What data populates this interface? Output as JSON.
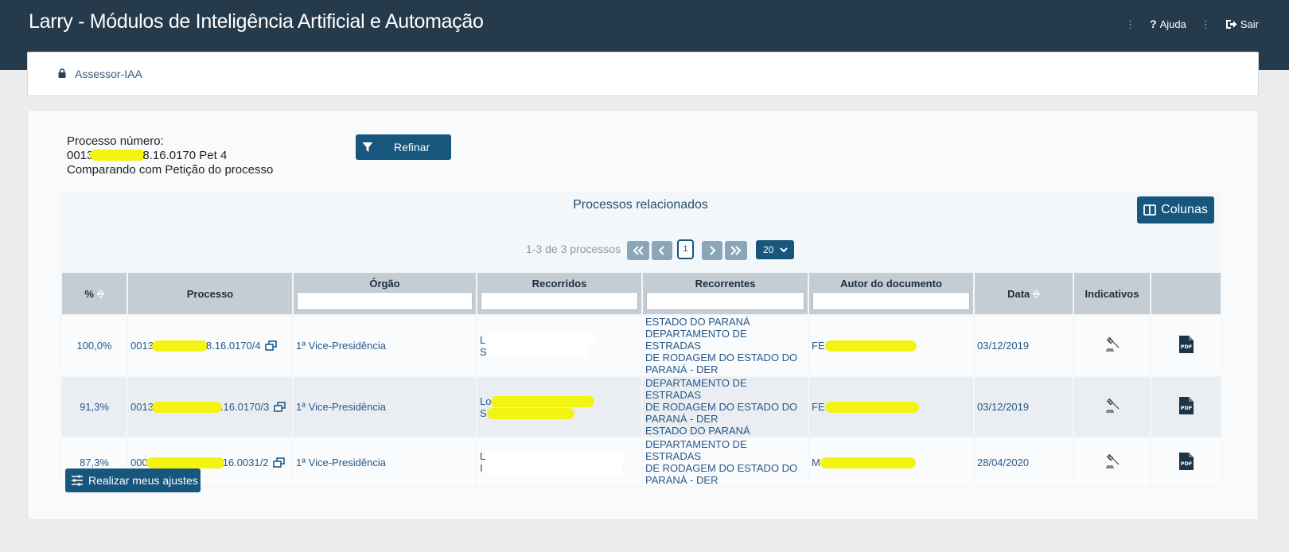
{
  "header": {
    "title": "Larry - Módulos de Inteligência Artificial e Automação",
    "help_label": "Ajuda",
    "exit_label": "Sair"
  },
  "breadcrumb": {
    "label": "Assessor-IAA"
  },
  "process": {
    "label": "Processo número:",
    "number_prefix": "0013",
    "number_suffix": "8.16.0170 Pet 4",
    "comparing": "Comparando com Petição do processo"
  },
  "toolbar": {
    "refine_label": "Refinar",
    "columns_label": "Colunas",
    "adjust_label": "Realizar meus ajustes"
  },
  "panel": {
    "title": "Processos relacionados"
  },
  "pagination": {
    "info": "1-3 de 3 processos",
    "current_page": "1",
    "page_size": "20"
  },
  "table": {
    "columns": {
      "pct": "%",
      "processo": "Processo",
      "orgao": "Órgão",
      "recorridos": "Recorridos",
      "recorrentes": "Recorrentes",
      "autor": "Autor do documento",
      "data": "Data",
      "indicativos": "Indicativos"
    },
    "rows": [
      {
        "pct": "100,0%",
        "proc_prefix": "0013",
        "proc_suffix": "8.16.0170/4",
        "orgao": "1ª Vice-Presidência",
        "recorridos_1": "L",
        "recorridos_2": "S",
        "recorrentes_1": "ESTADO DO PARANÁ",
        "recorrentes_2": "DEPARTAMENTO DE ESTRADAS",
        "recorrentes_3": "DE RODAGEM DO ESTADO DO",
        "recorrentes_4": "PARANÁ - DER",
        "autor_prefix": "FE",
        "data": "03/12/2019"
      },
      {
        "pct": "91,3%",
        "proc_prefix": "0013",
        "proc_suffix": ".16.0170/3",
        "orgao": "1ª Vice-Presidência",
        "recorridos_1": "Lo",
        "recorridos_2": "S",
        "recorrentes_1": "DEPARTAMENTO DE ESTRADAS",
        "recorrentes_2": "DE RODAGEM DO ESTADO DO",
        "recorrentes_3": "PARANÁ - DER",
        "recorrentes_4": "ESTADO DO PARANÁ",
        "autor_prefix": "FE",
        "data": "03/12/2019"
      },
      {
        "pct": "87,3%",
        "proc_prefix": "000",
        "proc_suffix": "16.0031/2",
        "orgao": "1ª Vice-Presidência",
        "recorridos_1": "L",
        "recorridos_2": "I",
        "recorrentes_1": "DEPARTAMENTO DE ESTRADAS",
        "recorrentes_2": "DE RODAGEM DO ESTADO DO",
        "recorrentes_3": "PARANÁ - DER",
        "recorrentes_4": "",
        "autor_prefix": "M",
        "data": "28/04/2020"
      }
    ]
  },
  "colors": {
    "header_bg": "#253a4b",
    "accent": "#17567d",
    "highlight": "#f4f413"
  },
  "icons": [
    "lock-icon",
    "question-icon",
    "exit-icon",
    "filter-icon",
    "columns-icon",
    "first-page-icon",
    "prev-page-icon",
    "next-page-icon",
    "last-page-icon",
    "sort-icon",
    "external-link-icon",
    "gavel-icon",
    "pdf-icon",
    "sliders-icon"
  ]
}
